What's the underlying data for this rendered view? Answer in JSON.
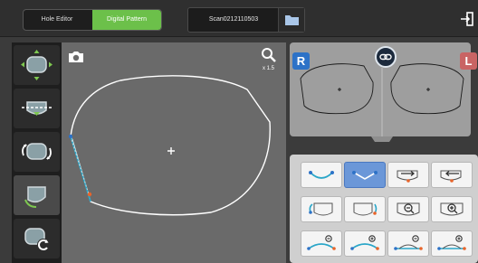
{
  "header": {
    "mode_tabs": [
      {
        "label": "Hole Editor"
      },
      {
        "label": "Digital Pattern",
        "active": true
      }
    ],
    "scan_name": "Scan0212110503",
    "accent_color": "#6cc04a"
  },
  "sidebar": {
    "tools": [
      "move-lens-icon",
      "horizontal-axis-icon",
      "rotate-lens-icon",
      "edit-shape-icon",
      "reset-shape-icon"
    ],
    "active_tool": "edit-shape-icon"
  },
  "canvas": {
    "zoom_label": "x 1.5",
    "background": "#6a6a6a"
  },
  "lens_preview": {
    "right_label": "R",
    "left_label": "L",
    "right_color": "#2d72c7",
    "left_color": "#c96464"
  },
  "tools_panel": {
    "rows": [
      [
        "curve-convex-icon",
        "curve-concave-icon",
        "arrow-right-icon",
        "arrow-left-icon"
      ],
      [
        "rotate-left-lens-icon",
        "flip-lens-icon",
        "zoom-out-lens-icon",
        "zoom-in-lens-icon"
      ],
      [
        "shrink-bottom-icon",
        "grow-bottom-icon",
        "shrink-height-icon",
        "grow-height-icon"
      ]
    ],
    "selected": "curve-concave-icon"
  }
}
